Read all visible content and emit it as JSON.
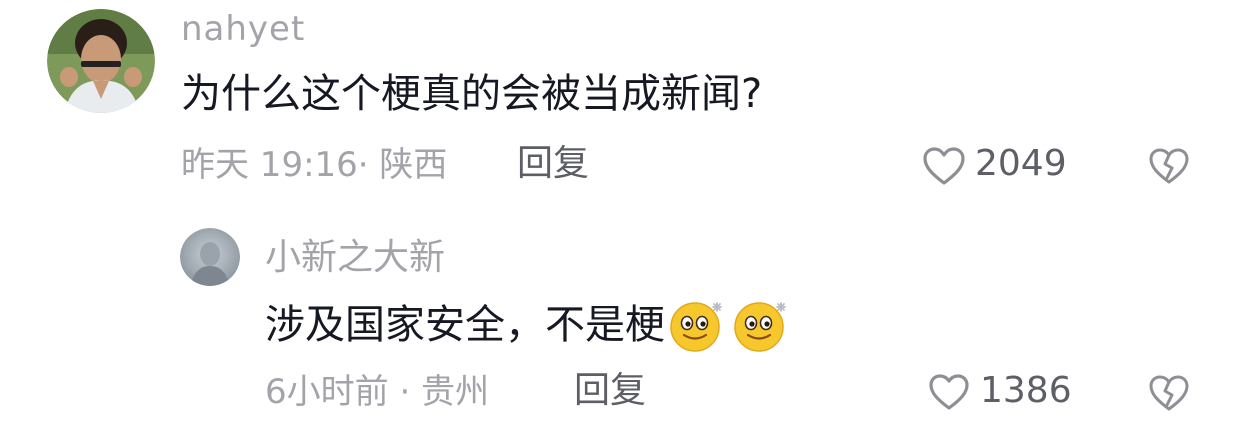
{
  "comments": [
    {
      "username": "nahyet",
      "text": "为什么这个梗真的会被当成新闻?",
      "time": "昨天 19:16",
      "separator": "·",
      "location": "陕西",
      "reply_label": "回复",
      "like_count": "2049",
      "avatar_icon": "user-avatar-photo",
      "like_icon": "heart-outline-icon",
      "dislike_icon": "broken-heart-icon"
    },
    {
      "username": "小新之大新",
      "text": "涉及国家安全，不是梗",
      "emojis": [
        "smiling-face-emoji",
        "smiling-face-emoji"
      ],
      "time": "6小时前",
      "separator": "·",
      "location": "贵州",
      "reply_label": "回复",
      "like_count": "1386",
      "avatar_icon": "user-avatar-photo",
      "like_icon": "heart-outline-icon",
      "dislike_icon": "broken-heart-icon"
    }
  ],
  "colors": {
    "username": "#a3a3aa",
    "content": "#161823",
    "meta": "#a3a3aa",
    "action": "#5e5f66",
    "background": "#ffffff"
  }
}
